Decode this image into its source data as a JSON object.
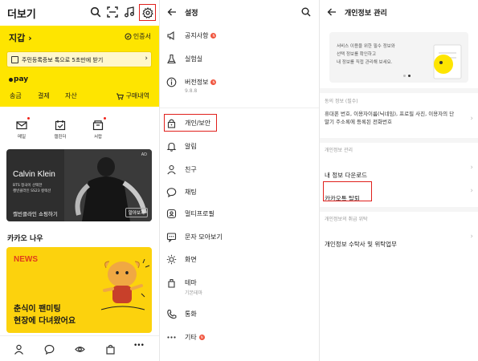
{
  "panel1": {
    "title": "더보기",
    "wallet_title": "지갑",
    "wallet_chevron": "›",
    "cert_label": "인증서",
    "id_banner_text": "주민등록증보 톡으로 5초만에 받기",
    "pay_label": "pay",
    "pay_tabs": [
      "송금",
      "결제",
      "자산"
    ],
    "orders_label": "구매내역",
    "shortcuts": [
      {
        "label": "메일",
        "icon": "mail-icon",
        "has_dot": true
      },
      {
        "label": "캘린더",
        "icon": "calendar-icon",
        "has_dot": false
      },
      {
        "label": "서랍",
        "icon": "drawer-icon",
        "has_dot": true
      }
    ],
    "ad": {
      "tag": "AD",
      "brand": "Calvin Klein",
      "desc_line1": "BTS 정국이 선택한",
      "desc_line2": "캘빈클라인 SS23 컬렉션",
      "cta": "캘빈클라인 쇼핑하기",
      "more_label": "알아보기"
    },
    "now_title": "카카오 나우",
    "news_label": "NEWS",
    "news_line1": "춘식이 팬미팅",
    "news_line2": "현장에 다녀왔어요",
    "bottom_nav": [
      "friends-icon",
      "chat-icon",
      "view-icon",
      "shopping-icon",
      "more-icon"
    ],
    "more_glyph": "•••",
    "colors": {
      "brand_yellow": "#fee500",
      "highlight_red": "#e0201c"
    }
  },
  "panel2": {
    "title": "설정",
    "items": [
      {
        "label": "공지사항",
        "icon": "speaker-icon",
        "badge": "N"
      },
      {
        "label": "실험실",
        "icon": "flask-icon"
      },
      {
        "label": "버전정보",
        "icon": "info-icon",
        "badge": "N",
        "sub": "9.8.8"
      },
      {
        "label": "개인/보안",
        "icon": "lock-icon",
        "highlighted": true
      },
      {
        "label": "알림",
        "icon": "bell-icon"
      },
      {
        "label": "친구",
        "icon": "person-icon"
      },
      {
        "label": "채팅",
        "icon": "chat-bubble-icon"
      },
      {
        "label": "멀티프로필",
        "icon": "multi-profile-icon"
      },
      {
        "label": "문자 모아보기",
        "icon": "sms-icon"
      },
      {
        "label": "화면",
        "icon": "sun-icon"
      },
      {
        "label": "테마",
        "icon": "theme-icon",
        "sub": "기본테마"
      },
      {
        "label": "통화",
        "icon": "phone-icon"
      },
      {
        "label": "기타",
        "icon": "dots-icon",
        "badge": "N"
      }
    ]
  },
  "panel3": {
    "title": "개인정보 관리",
    "info_line1": "서비스 이용을 위한 필수 정보와",
    "info_line2": "선택 정보를 확인하고",
    "info_line3": "내 정보를 직접 관리해 보세요.",
    "section1_label": "동의 정보 (필수)",
    "section1_desc": "휴대폰 번호, 이용자이름(닉네임), 프로필 사진, 이용자의 단말기 주소록에 등록된 전화번호",
    "section2_label": "개인정보 관리",
    "download_label": "내 정보 다운로드",
    "withdraw_label": "카카오톡 탈퇴",
    "section3_label": "개인정보의 취급 위탁",
    "consignee_label": "개인정보 수탁사 및 위탁업무",
    "chevron": "›"
  }
}
